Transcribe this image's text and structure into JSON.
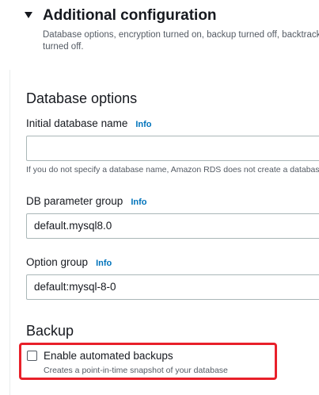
{
  "additional_config": {
    "title": "Additional configuration",
    "description": "Database options, encryption turned on, backup turned off, backtrack turned off."
  },
  "database_options": {
    "heading": "Database options",
    "initial_db_name": {
      "label": "Initial database name",
      "info": "Info",
      "value": "",
      "hint": "If you do not specify a database name, Amazon RDS does not create a database."
    },
    "db_parameter_group": {
      "label": "DB parameter group",
      "info": "Info",
      "value": "default.mysql8.0"
    },
    "option_group": {
      "label": "Option group",
      "info": "Info",
      "value": "default:mysql-8-0"
    }
  },
  "backup": {
    "heading": "Backup",
    "enable_automated_backups": {
      "label": "Enable automated backups",
      "description": "Creates a point-in-time snapshot of your database",
      "checked": false
    },
    "highlight_color": "#e8202a"
  },
  "colors": {
    "text": "#16191f",
    "secondary": "#545b64",
    "link": "#0073bb",
    "border": "#aab7b8"
  }
}
